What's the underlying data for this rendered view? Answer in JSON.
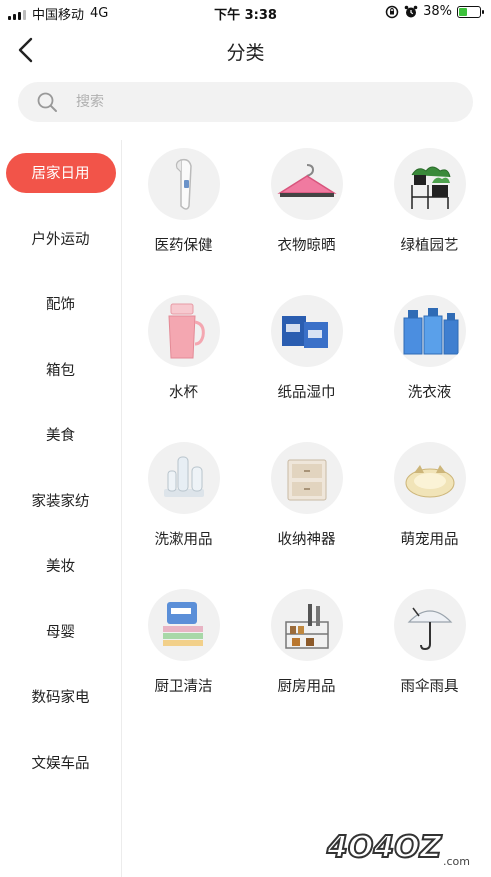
{
  "status_bar": {
    "carrier": "中国移动",
    "network": "4G",
    "time": "下午 3:38",
    "battery": "38%",
    "battery_level": 0.38
  },
  "nav": {
    "title": "分类",
    "back_icon": "chevron-left-icon"
  },
  "search": {
    "placeholder": "搜索",
    "icon": "search-icon"
  },
  "sidebar": {
    "items": [
      {
        "label": "居家日用",
        "active": true
      },
      {
        "label": "户外运动"
      },
      {
        "label": "配饰"
      },
      {
        "label": "箱包"
      },
      {
        "label": "美食"
      },
      {
        "label": "家装家纺"
      },
      {
        "label": "美妆"
      },
      {
        "label": "母婴"
      },
      {
        "label": "数码家电"
      },
      {
        "label": "文娱车品"
      }
    ]
  },
  "categories": [
    {
      "label": "医药保健",
      "icon": "thermometer-icon"
    },
    {
      "label": "衣物晾晒",
      "icon": "hanger-icon"
    },
    {
      "label": "绿植园艺",
      "icon": "plant-icon"
    },
    {
      "label": "水杯",
      "icon": "cup-icon"
    },
    {
      "label": "纸品湿巾",
      "icon": "tissue-icon"
    },
    {
      "label": "洗衣液",
      "icon": "detergent-icon"
    },
    {
      "label": "洗漱用品",
      "icon": "toothbrush-icon"
    },
    {
      "label": "收纳神器",
      "icon": "storage-box-icon"
    },
    {
      "label": "萌宠用品",
      "icon": "pet-bed-icon"
    },
    {
      "label": "厨卫清洁",
      "icon": "cleaning-cloth-icon"
    },
    {
      "label": "厨房用品",
      "icon": "kitchen-rack-icon"
    },
    {
      "label": "雨伞雨具",
      "icon": "umbrella-icon"
    }
  ],
  "watermark": {
    "text": "4O4OZ",
    "suffix": ".com"
  },
  "colors": {
    "accent": "#f25449",
    "thumb_bg": "#f1f1f1"
  }
}
